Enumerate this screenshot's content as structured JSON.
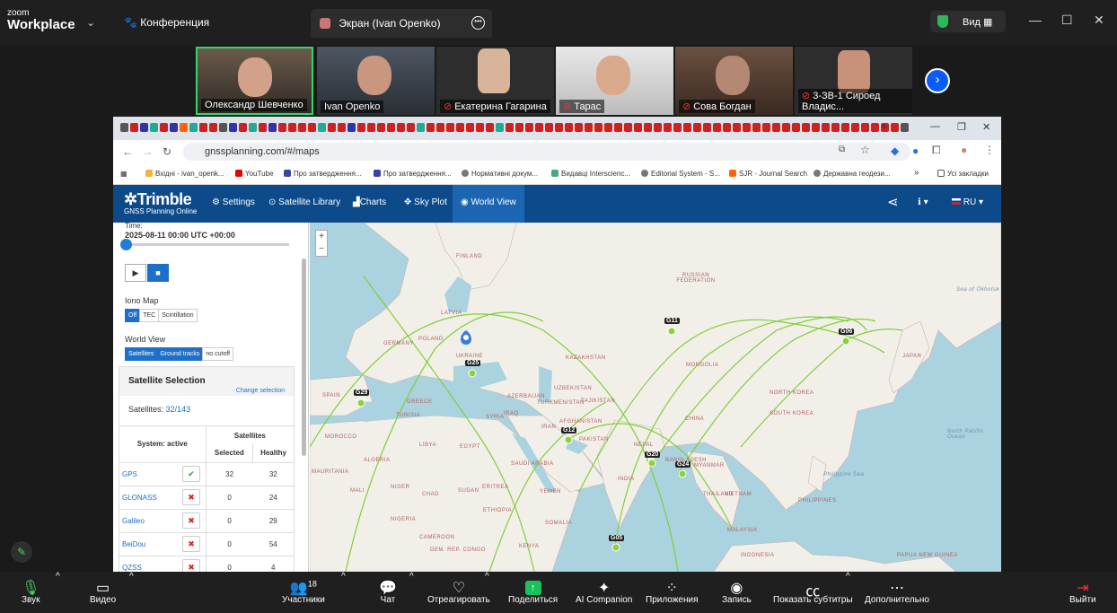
{
  "zoom": {
    "logo_top": "zoom",
    "logo_bottom": "Workplace",
    "meeting_title": "Конференция",
    "share_tab": "Экран (Ivan Openko)",
    "view_label": "Вид",
    "participants": [
      {
        "name": "Олександр Шевченко",
        "muted": false,
        "active": true
      },
      {
        "name": "Ivan Openko",
        "muted": false,
        "active": false
      },
      {
        "name": "Екатерина Гагарина",
        "muted": true,
        "active": false
      },
      {
        "name": "Тарас",
        "muted": true,
        "active": false
      },
      {
        "name": "Сова Богдан",
        "muted": true,
        "active": false
      },
      {
        "name": "3-ЗВ-1 Сироед Владис...",
        "muted": true,
        "active": false
      }
    ],
    "toolbar": {
      "audio": "Звук",
      "video": "Видео",
      "participants": "Участники",
      "participants_count": "18",
      "chat": "Чат",
      "react": "Отреагировать",
      "share": "Поделиться",
      "ai": "AI Companion",
      "apps": "Приложения",
      "record": "Запись",
      "captions": "Показать субтитры",
      "more": "Дополнительно",
      "leave": "Выйти"
    }
  },
  "browser": {
    "url": "gnssplanning.com/#/maps",
    "bookmarks": [
      "Вхідні - ivan_openk...",
      "YouTube",
      "Про затвердження...",
      "Про затвердження...",
      "Нормативні докум...",
      "Видавці Interscienc...",
      "Editorial System - S...",
      "SJR - Journal Search",
      "Державна геодези...",
      "»",
      "Усі закладки"
    ]
  },
  "app": {
    "brand": "Trimble",
    "brand_sub": "GNSS Planning Online",
    "nav": [
      "Settings",
      "Satellite Library",
      "Charts",
      "Sky Plot",
      "World View"
    ],
    "nav_selected": "World View",
    "language": "RU",
    "sidebar": {
      "time_label": "Time:",
      "time_value": "2025-08-11 00:00 UTC +00:00",
      "iono_label": "Iono Map",
      "iono_options": [
        "Off",
        "TEC",
        "Scintillation"
      ],
      "iono_selected": "Off",
      "world_label": "World View",
      "world_options": [
        "Satellites",
        "Ground tracks",
        "no cutoff"
      ],
      "sat_selection_title": "Satellite Selection",
      "change_selection": "Change selection",
      "satellites_label": "Satellites:",
      "satellites_value": "32/143",
      "table": {
        "col_system": "System: active",
        "col_group": "Satellites",
        "col_selected": "Selected",
        "col_healthy": "Healthy",
        "rows": [
          {
            "system": "GPS",
            "active": true,
            "selected": "32",
            "healthy": "32"
          },
          {
            "system": "GLONASS",
            "active": false,
            "selected": "0",
            "healthy": "24"
          },
          {
            "system": "Galileo",
            "active": false,
            "selected": "0",
            "healthy": "29"
          },
          {
            "system": "BeiDou",
            "active": false,
            "selected": "0",
            "healthy": "54"
          },
          {
            "system": "QZSS",
            "active": false,
            "selected": "0",
            "healthy": "4"
          }
        ]
      }
    },
    "map": {
      "labels": [
        "RUSSIAN FEDERATION",
        "FINLAND",
        "LATVIA",
        "POLAND",
        "GERMANY",
        "UKRAINE",
        "KAZAKHSTAN",
        "MONGOLIA",
        "CHINA",
        "UZBEKISTAN",
        "TURKMENISTAN",
        "TAJIKISTAN",
        "AFGHANISTAN",
        "PAKISTAN",
        "IRAN",
        "IRAQ",
        "SYRIA",
        "SAUDI ARABIA",
        "EGYPT",
        "LIBYA",
        "ALGERIA",
        "MOROCCO",
        "SPAIN",
        "GREECE",
        "TUNISIA",
        "AZERBAIJAN",
        "ERITREA",
        "YEMEN",
        "SUDAN",
        "ETHIOPIA",
        "CHAD",
        "NIGER",
        "MALI",
        "MAURITANIA",
        "NIGERIA",
        "CAMEROON",
        "NEPAL",
        "BANGLADESH",
        "INDIA",
        "MYANMAR",
        "THAILAND",
        "VIETNAM",
        "PHILIPPINES",
        "MALAYSIA",
        "INDONESIA",
        "JAPAN",
        "NORTH KOREA",
        "SOUTH KOREA",
        "PAPUA NEW GUINEA",
        "SOMALIA",
        "KENYA",
        "DEM. REP. CONGO",
        "Sea of Okhotsk",
        "Philippine Sea",
        "North Pacific Ocean"
      ],
      "satellites": [
        "G11",
        "G06",
        "G25",
        "G29",
        "G12",
        "G20",
        "G24",
        "G05"
      ]
    }
  }
}
